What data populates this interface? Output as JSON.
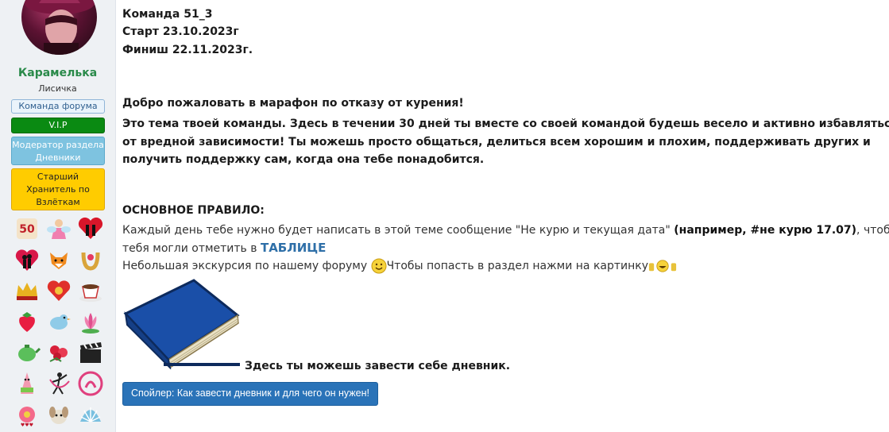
{
  "user": {
    "name": "Карамелька",
    "subtitle": "Лисичка",
    "badges": {
      "team": "Команда форума",
      "vip": "V.I.P",
      "moderator": "Модератор раздела Дневники",
      "keeper": "Старший Хранитель по Взлёткам"
    },
    "awards": [
      "50-days-award-icon",
      "fairy-award-icon",
      "couple-heart-award-icon",
      "couple-silhouette-award-icon",
      "fox-award-icon",
      "horseshoe-award-icon",
      "crown-award-icon",
      "heart-ornament-award-icon",
      "coffee-cup-award-icon",
      "strawberry-award-icon",
      "bird-award-icon",
      "lotus-award-icon",
      "teapot-award-icon",
      "roses-award-icon",
      "clapperboard-award-icon",
      "patrick-award-icon",
      "dancer-award-icon",
      "circle-logo-award-icon",
      "flower-text-award-icon",
      "puppy-award-icon",
      "shell-award-icon"
    ]
  },
  "post": {
    "team": "Команда 51_3",
    "start": "Старт 23.10.2023г",
    "finish": "Финиш 22.11.2023г.",
    "welcome": "Добро пожаловать в марафон по отказу от курения!",
    "paragraph": "Это тема твоей команды. Здесь в течении 30 дней ты вместе со своей командой будешь весело и активно избавляться от вредной зависимости! Ты можешь просто общаться, делиться всем хорошим и плохим, поддерживать других и получить поддержку сам, когда она тебе понадобится.",
    "rule_title": "ОСНОВНОЕ ПРАВИЛО:",
    "rule_text_1": "Каждый день тебе нужно будет написать в этой теме сообщение \"Не курю и текущая дата\" ",
    "rule_example": "(например, #не курю 17.07)",
    "rule_text_2": ", чтобы тебя могли отметить в ",
    "table_link": "ТАБЛИЦЕ",
    "tour_text_1": "Небольшая экскурсия по нашему форуму ",
    "tour_text_2": "Чтобы попасть в раздел нажми на картинку",
    "diary_text": "Здесь ты можешь завести себе дневник.",
    "spoiler": "Спойлер: Как завести дневник и для чего он нужен!"
  }
}
